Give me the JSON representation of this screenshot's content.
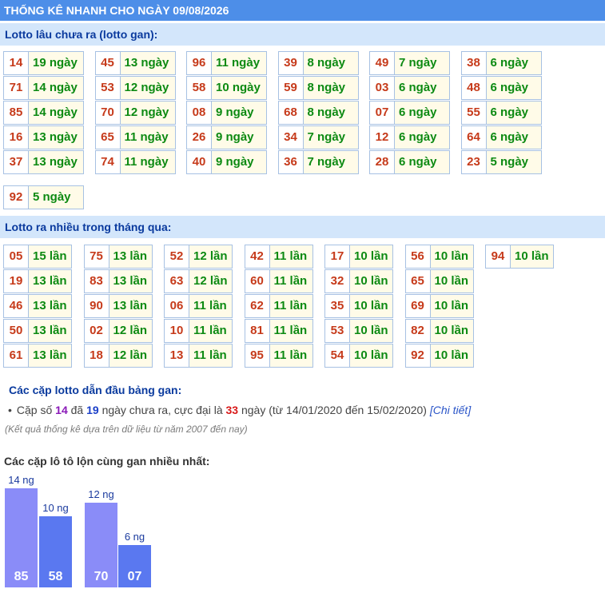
{
  "title": "THỐNG KÊ NHANH CHO NGÀY 09/08/2026",
  "gan": {
    "heading": "Lotto lâu chưa ra (lotto gan):",
    "columns": [
      [
        [
          "14",
          "19 ngày"
        ],
        [
          "71",
          "14 ngày"
        ],
        [
          "85",
          "14 ngày"
        ],
        [
          "16",
          "13 ngày"
        ],
        [
          "37",
          "13 ngày"
        ]
      ],
      [
        [
          "45",
          "13 ngày"
        ],
        [
          "53",
          "12 ngày"
        ],
        [
          "70",
          "12 ngày"
        ],
        [
          "65",
          "11 ngày"
        ],
        [
          "74",
          "11 ngày"
        ]
      ],
      [
        [
          "96",
          "11 ngày"
        ],
        [
          "58",
          "10 ngày"
        ],
        [
          "08",
          "9 ngày"
        ],
        [
          "26",
          "9 ngày"
        ],
        [
          "40",
          "9 ngày"
        ]
      ],
      [
        [
          "39",
          "8 ngày"
        ],
        [
          "59",
          "8 ngày"
        ],
        [
          "68",
          "8 ngày"
        ],
        [
          "34",
          "7 ngày"
        ],
        [
          "36",
          "7 ngày"
        ]
      ],
      [
        [
          "49",
          "7 ngày"
        ],
        [
          "03",
          "6 ngày"
        ],
        [
          "07",
          "6 ngày"
        ],
        [
          "12",
          "6 ngày"
        ],
        [
          "28",
          "6 ngày"
        ]
      ],
      [
        [
          "38",
          "6 ngày"
        ],
        [
          "48",
          "6 ngày"
        ],
        [
          "55",
          "6 ngày"
        ],
        [
          "64",
          "6 ngày"
        ],
        [
          "23",
          "5 ngày"
        ]
      ],
      [
        [
          "92",
          "5 ngày"
        ]
      ]
    ]
  },
  "nhieu": {
    "heading": "Lotto ra nhiều trong tháng qua:",
    "columns": [
      [
        [
          "05",
          "15 lần"
        ],
        [
          "19",
          "13 lần"
        ],
        [
          "46",
          "13 lần"
        ],
        [
          "50",
          "13 lần"
        ],
        [
          "61",
          "13 lần"
        ]
      ],
      [
        [
          "75",
          "13 lần"
        ],
        [
          "83",
          "13 lần"
        ],
        [
          "90",
          "13 lần"
        ],
        [
          "02",
          "12 lần"
        ],
        [
          "18",
          "12 lần"
        ]
      ],
      [
        [
          "52",
          "12 lần"
        ],
        [
          "63",
          "12 lần"
        ],
        [
          "06",
          "11 lần"
        ],
        [
          "10",
          "11 lần"
        ],
        [
          "13",
          "11 lần"
        ]
      ],
      [
        [
          "42",
          "11 lần"
        ],
        [
          "60",
          "11 lần"
        ],
        [
          "62",
          "11 lần"
        ],
        [
          "81",
          "11 lần"
        ],
        [
          "95",
          "11 lần"
        ]
      ],
      [
        [
          "17",
          "10 lần"
        ],
        [
          "32",
          "10 lần"
        ],
        [
          "35",
          "10 lần"
        ],
        [
          "53",
          "10 lần"
        ],
        [
          "54",
          "10 lần"
        ]
      ],
      [
        [
          "56",
          "10 lần"
        ],
        [
          "65",
          "10 lần"
        ],
        [
          "69",
          "10 lần"
        ],
        [
          "82",
          "10 lần"
        ],
        [
          "92",
          "10 lần"
        ]
      ],
      [
        [
          "94",
          "10 lần"
        ]
      ]
    ]
  },
  "pairs": {
    "heading": "Các cặp lotto dẫn đầu bảng gan:",
    "text1": "Cặp số",
    "num1": "14",
    "text2": "đã",
    "num2": "19",
    "text3": "ngày chưa ra, cực đại là",
    "num3": "33",
    "text4": "ngày (từ 14/01/2020 đến 15/02/2020)",
    "link": "[Chi tiết]"
  },
  "note": "(Kết quả thống kê dựa trên dữ liệu từ năm 2007 đến nay)",
  "chart_heading": "Các cặp lô tô lộn cùng gan nhiều nhất:",
  "colors": {
    "bar_light": "#8a8cf8",
    "bar_dark": "#5a78f0",
    "header": "#4d8ee8",
    "section": "#d3e6fb"
  },
  "chart_data": {
    "type": "bar",
    "categories": [
      "85",
      "58",
      "70",
      "07"
    ],
    "values": [
      14,
      10,
      12,
      6
    ],
    "labels": [
      "14 ng",
      "10 ng",
      "12 ng",
      "6 ng"
    ],
    "groups": [
      [
        "85",
        "58"
      ],
      [
        "70",
        "07"
      ]
    ]
  }
}
